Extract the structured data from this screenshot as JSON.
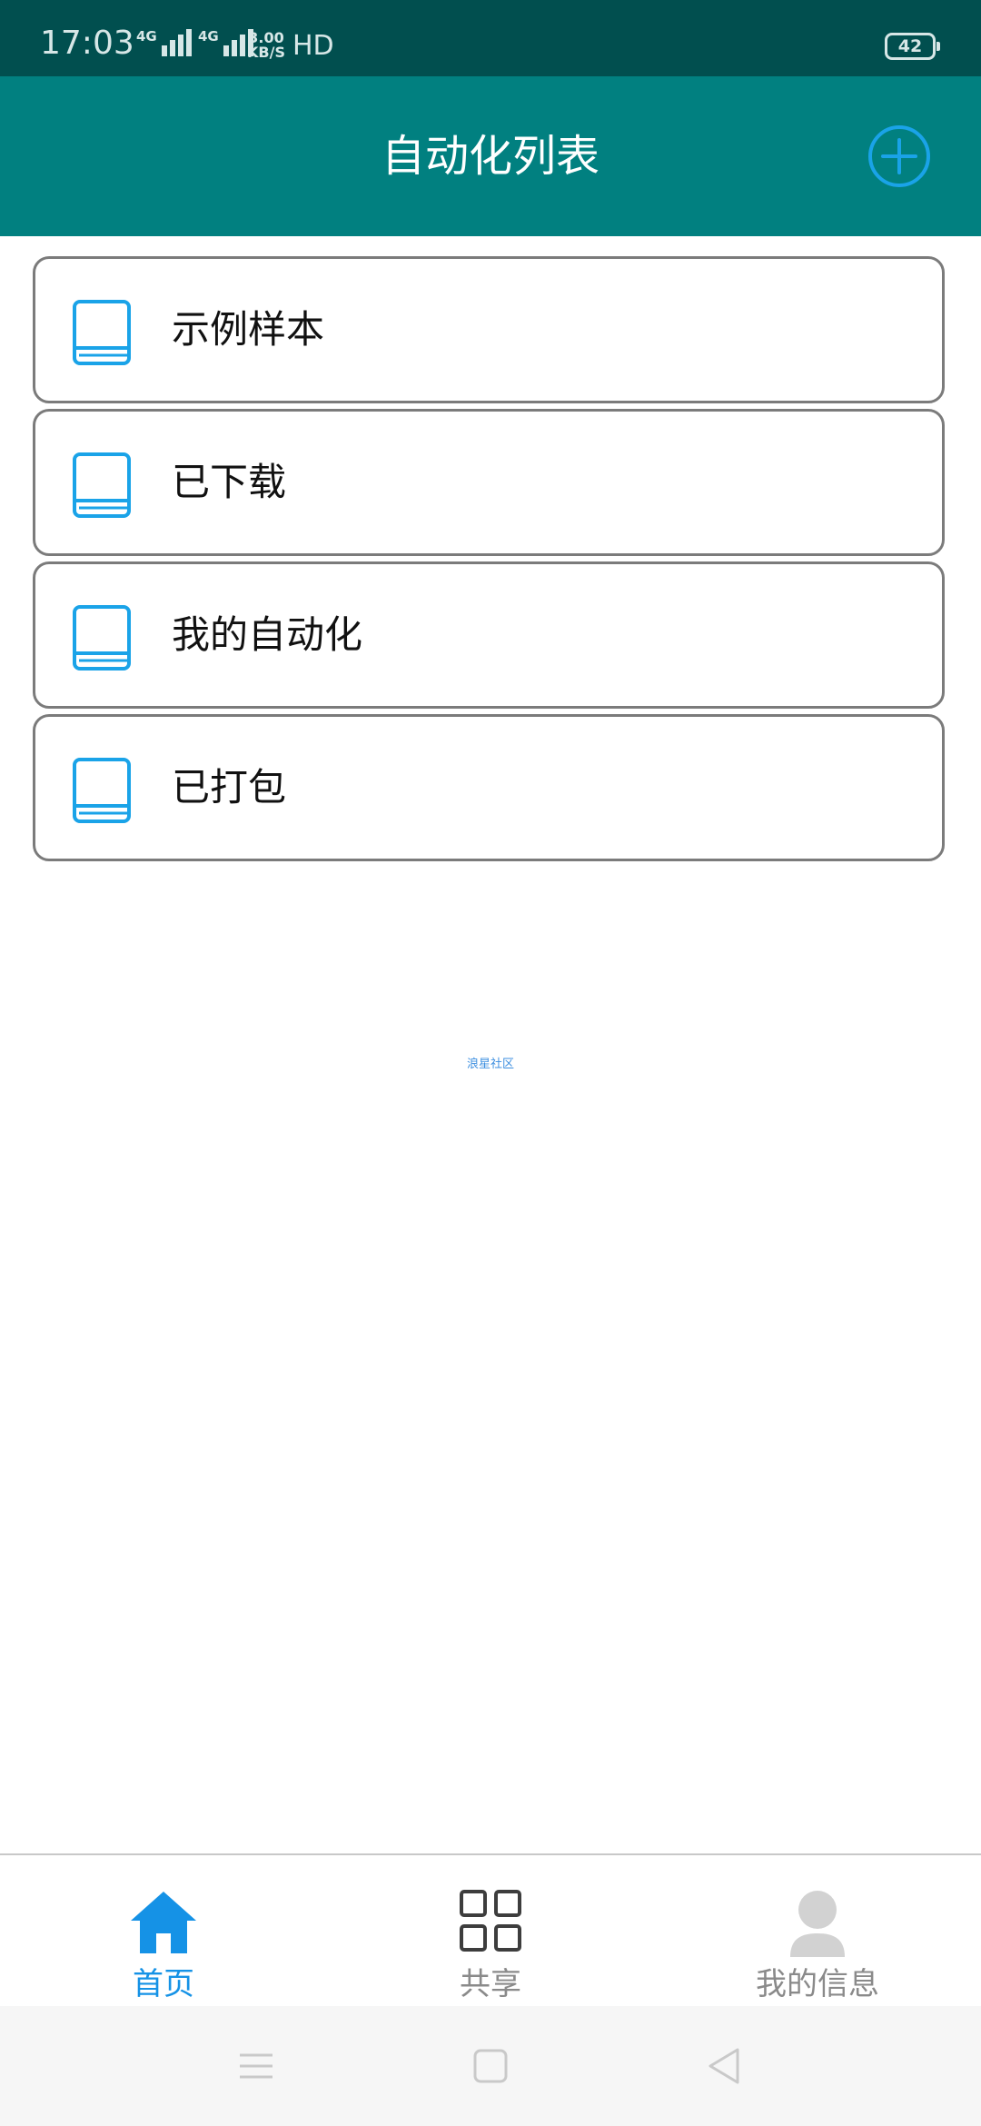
{
  "status_bar": {
    "time": "17:03",
    "network_1": "4G",
    "network_2": "4G",
    "speed_value": "3.00",
    "speed_unit": "KB/S",
    "hd": "HD",
    "battery": "42"
  },
  "header": {
    "title": "自动化列表",
    "add_icon": "plus-circle-icon"
  },
  "list": {
    "icon": "book-icon",
    "icon_color": "#1aa3e8",
    "items": [
      {
        "label": "示例样本"
      },
      {
        "label": "已下载"
      },
      {
        "label": "我的自动化"
      },
      {
        "label": "已打包"
      }
    ]
  },
  "community_link": "浪星社区",
  "tab_bar": {
    "active_color": "#1592e6",
    "inactive_color": "#8a8a8a",
    "tabs": [
      {
        "label": "首页",
        "icon": "home-icon",
        "active": true
      },
      {
        "label": "共享",
        "icon": "grid-icon",
        "active": false
      },
      {
        "label": "我的信息",
        "icon": "user-icon",
        "active": false
      }
    ]
  },
  "system_nav": {
    "buttons": [
      "menu-icon",
      "home-square-icon",
      "back-triangle-icon"
    ]
  }
}
